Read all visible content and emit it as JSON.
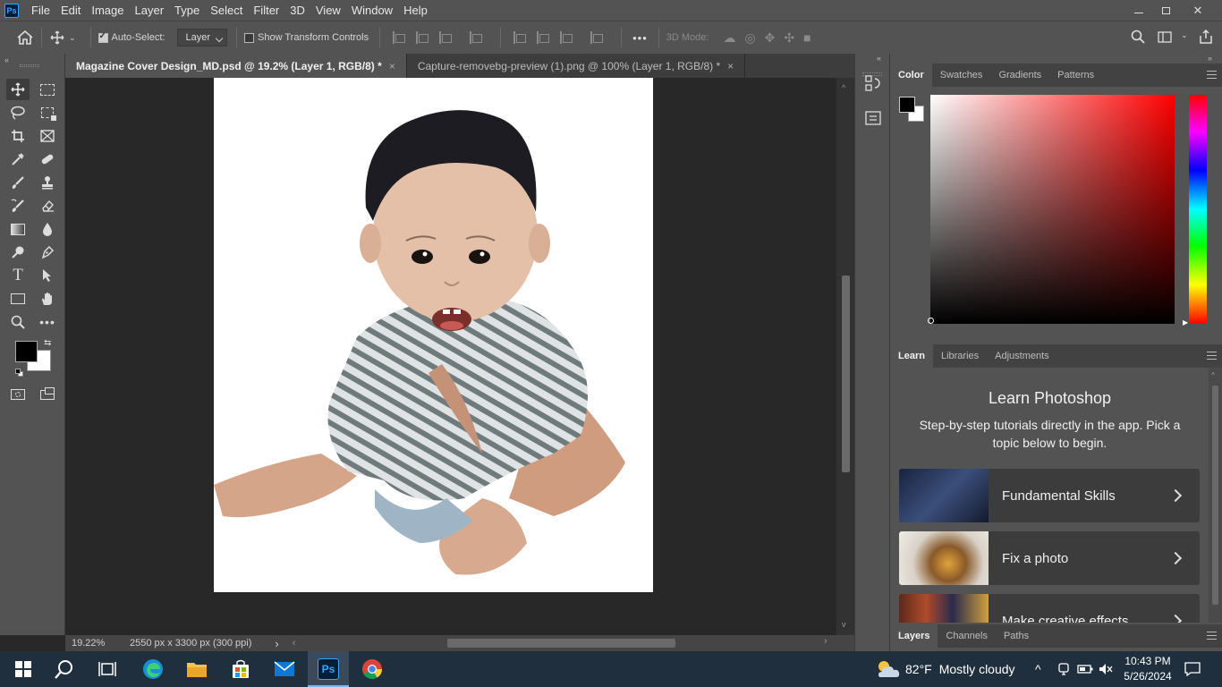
{
  "app": {
    "menu": [
      "File",
      "Edit",
      "Image",
      "Layer",
      "Type",
      "Select",
      "Filter",
      "3D",
      "View",
      "Window",
      "Help"
    ],
    "logo": "Ps"
  },
  "options_bar": {
    "auto_select_label": "Auto-Select:",
    "auto_select_checked": true,
    "auto_select_target": "Layer",
    "transform_controls_label": "Show Transform Controls",
    "transform_controls_checked": false,
    "three_d_mode_label": "3D Mode:",
    "more_label": "•••"
  },
  "tabs": [
    {
      "label": "Magazine Cover Design_MD.psd @ 19.2% (Layer 1, RGB/8) *",
      "active": true,
      "close": "×"
    },
    {
      "label": "Capture-removebg-preview (1).png @ 100% (Layer 1, RGB/8) *",
      "active": false,
      "close": "×"
    }
  ],
  "status": {
    "zoom": "19.22%",
    "doc_info": "2550 px x 3300 px (300 ppi)",
    "arrow": "›"
  },
  "panels": {
    "color_tabs": [
      "Color",
      "Swatches",
      "Gradients",
      "Patterns"
    ],
    "learn_tabs": [
      "Learn",
      "Libraries",
      "Adjustments"
    ],
    "layers_tabs": [
      "Layers",
      "Channels",
      "Paths"
    ],
    "learn": {
      "title": "Learn Photoshop",
      "subtitle": "Step-by-step tutorials directly in the app. Pick a topic below to begin.",
      "cards": [
        "Fundamental Skills",
        "Fix a photo",
        "Make creative effects"
      ]
    },
    "foreground_color": "#000000",
    "background_color": "#ffffff"
  },
  "taskbar": {
    "weather_temp": "82°F",
    "weather_desc": "Mostly cloudy",
    "time": "10:43 PM",
    "date": "5/26/2024"
  }
}
